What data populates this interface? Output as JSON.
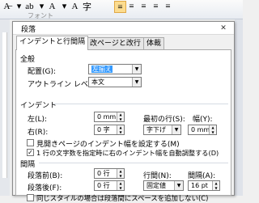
{
  "ribbon": {
    "font_group_label": "フォント",
    "buttons": [
      {
        "name": "clear-format-icon",
        "glyph": "A̶",
        "selected": false
      },
      {
        "name": "font-color-dropdown-icon",
        "glyph": "▾",
        "selected": false
      },
      {
        "name": "highlight-icon",
        "glyph": "ab",
        "selected": false
      },
      {
        "name": "highlight-dropdown-icon",
        "glyph": "▾",
        "selected": false
      },
      {
        "name": "font-color-icon",
        "glyph": "A",
        "selected": false
      },
      {
        "name": "font-color-dropdown2-icon",
        "glyph": "▾",
        "selected": false
      },
      {
        "name": "char-shading-icon",
        "glyph": "A",
        "selected": false
      },
      {
        "name": "enclosed-char-icon",
        "glyph": "字",
        "selected": false
      },
      {
        "name": "align-left-icon",
        "glyph": "≡",
        "selected": true
      },
      {
        "name": "align-center-icon",
        "glyph": "≡",
        "selected": false
      },
      {
        "name": "align-right-icon",
        "glyph": "≡",
        "selected": false
      },
      {
        "name": "justify-icon",
        "glyph": "≡",
        "selected": false
      },
      {
        "name": "distributed-icon",
        "glyph": "≡",
        "selected": false
      }
    ]
  },
  "dialog": {
    "title": "段落",
    "close": "✕",
    "tabs": [
      "インデントと行間隔",
      "改ページと改行",
      "体裁"
    ],
    "general": {
      "heading": "全般",
      "alignment_label": "配置(G):",
      "alignment_value": "左揃え",
      "outline_label": "アウトライン レベル(O):",
      "outline_value": "本文"
    },
    "indent": {
      "heading": "インデント",
      "left_label": "左(L):",
      "left_value": "0 mm",
      "right_label": "右(R):",
      "right_value": "0 字",
      "first_line_label": "最初の行(S):",
      "first_line_value": "字下げ",
      "width_label": "幅(Y):",
      "width_value": "0 mm",
      "mirror_label": "見開きページのインデント幅を設定する(M)",
      "mirror_checked": false,
      "auto_adjust_label": "1 行の文字数を指定時に右のインデント幅を自動調整する(D)",
      "auto_adjust_checked": true
    },
    "spacing": {
      "heading": "間隔",
      "before_label": "段落前(B):",
      "before_value": "0 行",
      "after_label": "段落後(F):",
      "after_value": "0 行",
      "line_label": "行間(N):",
      "line_value": "固定値",
      "at_label": "間隔(A):",
      "at_value": "16 pt",
      "same_style_label": "同じスタイルの場合は段落間にスペースを追加しない(C)",
      "same_style_checked": false
    }
  }
}
